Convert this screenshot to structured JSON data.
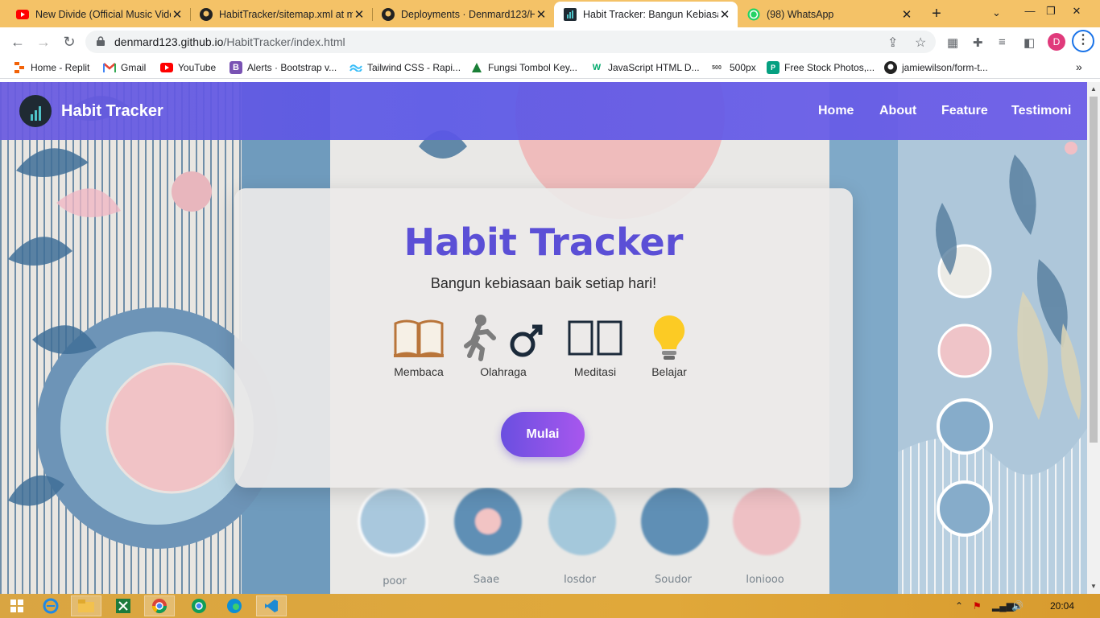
{
  "browser": {
    "tabs": [
      {
        "title": "New Divide (Official Music Vide",
        "icon": "youtube-icon"
      },
      {
        "title": "HabitTracker/sitemap.xml at m",
        "icon": "github-icon"
      },
      {
        "title": "Deployments · Denmard123/H",
        "icon": "github-icon"
      },
      {
        "title": "Habit Tracker: Bangun Kebiasa",
        "icon": "habit-tracker-icon",
        "active": true
      },
      {
        "title": "(98) WhatsApp",
        "icon": "whatsapp-icon"
      }
    ],
    "url_host": "denmard123.github.io",
    "url_path": "/HabitTracker/index.html",
    "profile_initial": "D",
    "bookmarks": [
      {
        "label": "Home - Replit",
        "icon": "replit-icon"
      },
      {
        "label": "Gmail",
        "icon": "gmail-icon"
      },
      {
        "label": "YouTube",
        "icon": "youtube-icon"
      },
      {
        "label": "Alerts · Bootstrap v...",
        "icon": "bootstrap-icon",
        "glyph": "B"
      },
      {
        "label": "Tailwind CSS - Rapi...",
        "icon": "tailwind-icon"
      },
      {
        "label": "Fungsi Tombol Key...",
        "icon": "keyboard-site-icon"
      },
      {
        "label": "JavaScript HTML D...",
        "icon": "w3schools-icon",
        "glyph": "W"
      },
      {
        "label": "500px",
        "icon": "500px-icon",
        "glyph": "500"
      },
      {
        "label": "Free Stock Photos,...",
        "icon": "pexels-icon",
        "glyph": "P"
      },
      {
        "label": "jamiewilson/form-t...",
        "icon": "github-icon"
      }
    ]
  },
  "site": {
    "brand": "Habit Tracker",
    "nav": [
      "Home",
      "About",
      "Feature",
      "Testimoni"
    ],
    "hero": {
      "title": "Habit Tracker",
      "subtitle": "Bangun kebiasaan baik setiap hari!",
      "habits": [
        {
          "emoji": "📖",
          "label": "Membaca"
        },
        {
          "emoji": "🏃‍♂️",
          "label": "Olahraga"
        },
        {
          "emoji": "🧘",
          "label": "Meditasi"
        },
        {
          "emoji": "💡",
          "label": "Belajar"
        }
      ],
      "cta": "Mulai"
    }
  },
  "taskbar": {
    "clock": "20:04"
  },
  "colors": {
    "navbar": "#5a57e6",
    "title": "#5b4fd6",
    "cta_start": "#6a4fe0",
    "cta_end": "#a857ee",
    "tabbar": "#f4c267"
  }
}
